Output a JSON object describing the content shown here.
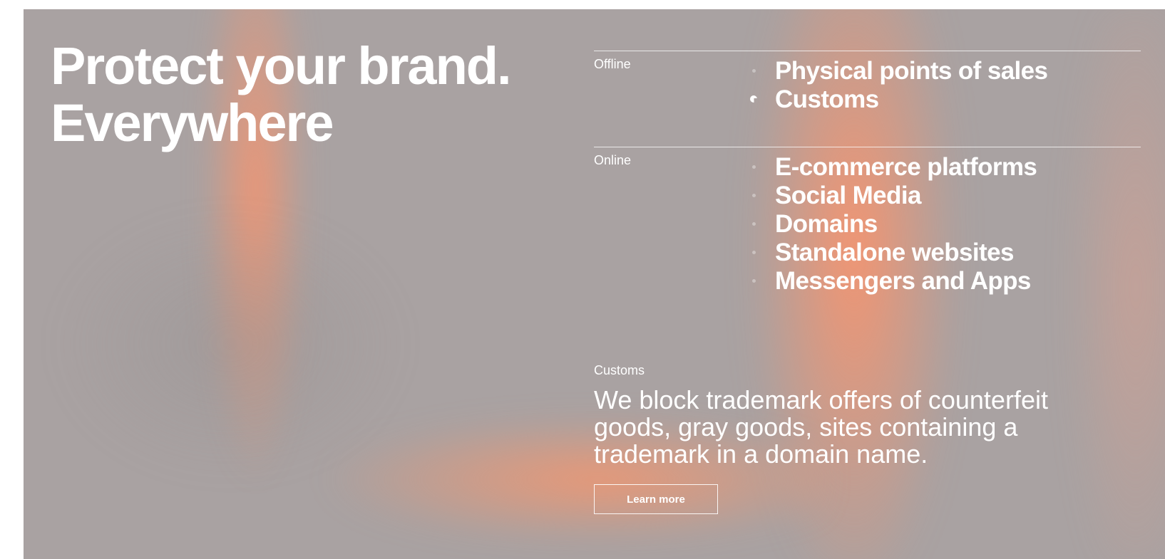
{
  "hero": {
    "headline_line1": "Protect your brand.",
    "headline_line2": "Everywhere"
  },
  "channels": {
    "offline": {
      "label": "Offline",
      "items": [
        {
          "label": "Physical points of sales",
          "active": false
        },
        {
          "label": "Customs",
          "active": true
        }
      ]
    },
    "online": {
      "label": "Online",
      "items": [
        {
          "label": "E-commerce platforms",
          "active": false
        },
        {
          "label": "Social Media",
          "active": false
        },
        {
          "label": "Domains",
          "active": false
        },
        {
          "label": "Standalone websites",
          "active": false
        },
        {
          "label": "Messengers and Apps",
          "active": false
        }
      ]
    }
  },
  "detail": {
    "label": "Customs",
    "description": "We block trademark offers of counterfeit goods, gray goods, sites containing a trademark in a domain name.",
    "button_label": "Learn more"
  },
  "colors": {
    "background": "#a9a2a2",
    "accent_glow": "#f8946e",
    "text": "#ffffff"
  }
}
